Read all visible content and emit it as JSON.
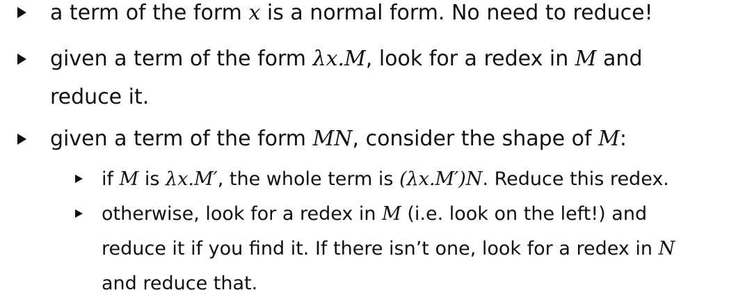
{
  "items": [
    {
      "text_before": "a term of the form",
      "math": "x",
      "text_after": "is a normal form. No need to reduce!"
    },
    {
      "text_before": "given a term of the form",
      "math1": "λx.M",
      "text_mid": ", look for a redex in",
      "math2": "M",
      "text_after": "and",
      "continuation": "reduce it."
    },
    {
      "text_before": "given a term of the form",
      "math1": "MN",
      "text_mid": ", consider the shape of",
      "math2": "M",
      "text_after": ":",
      "subitems": [
        {
          "w1": "if",
          "m1": "M",
          "w2": "is",
          "m2": "λx.M′",
          "w3": ", the whole term is",
          "m3": "(λx.M′)N",
          "w4": ". Reduce this redex."
        },
        {
          "w1": "otherwise, look for a redex in",
          "m1": "M",
          "w2": "(i.e. look on the left!) and",
          "line2_text": "reduce it if you find it. If there isn’t one, look for a redex in",
          "line2_math": "N",
          "line3": "and reduce that."
        }
      ]
    }
  ]
}
